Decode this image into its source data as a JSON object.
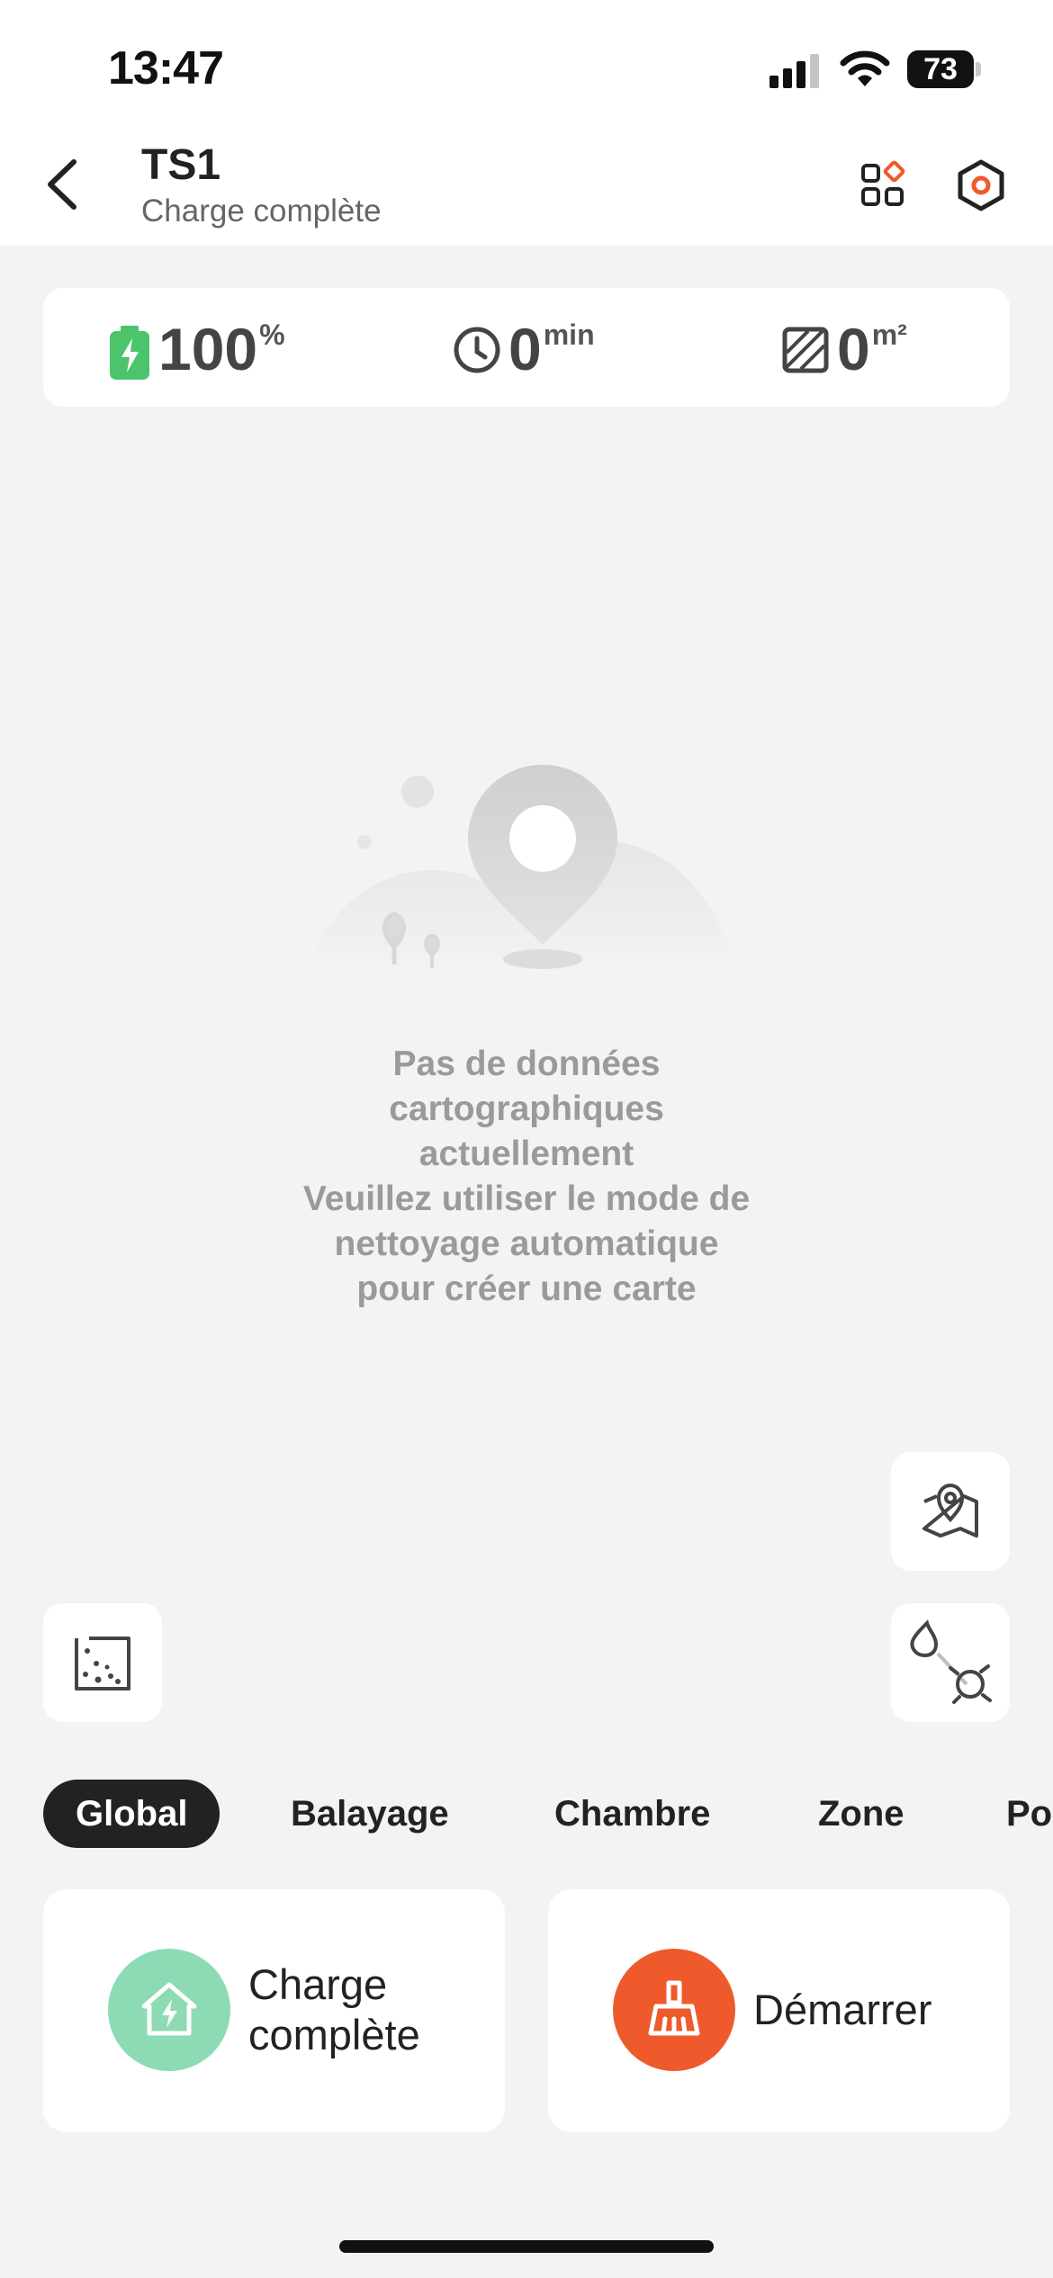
{
  "status_bar": {
    "time": "13:47",
    "battery_level": "73"
  },
  "header": {
    "title": "TS1",
    "subtitle": "Charge complète"
  },
  "stats": {
    "battery": {
      "value": "100",
      "unit": "%"
    },
    "time": {
      "value": "0",
      "unit": "min"
    },
    "area": {
      "value": "0",
      "unit": "m²"
    }
  },
  "empty_state": {
    "lines": [
      "Pas de données",
      "cartographiques",
      "actuellement",
      "Veuillez utiliser le mode de",
      "nettoyage automatique",
      "pour créer une carte"
    ]
  },
  "tabs": [
    {
      "label": "Global",
      "active": true
    },
    {
      "label": "Balayage",
      "active": false
    },
    {
      "label": "Chambre",
      "active": false
    },
    {
      "label": "Zone",
      "active": false
    },
    {
      "label": "Po",
      "active": false
    }
  ],
  "actions": {
    "charge": {
      "line1": "Charge",
      "line2": "complète",
      "icon": "home-charge-icon",
      "color": "#8ddbb4"
    },
    "start": {
      "label": "Démarrer",
      "icon": "broom-icon",
      "color": "#ee5a2c"
    }
  },
  "colors": {
    "accent": "#ee5a2c",
    "battery_green": "#4cc46b",
    "background": "#f3f3f3"
  }
}
